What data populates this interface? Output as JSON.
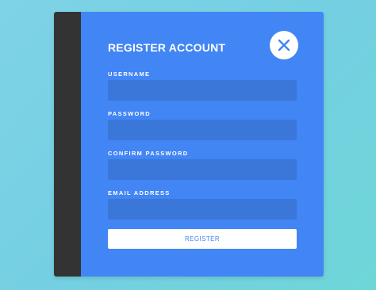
{
  "form": {
    "title": "REGISTER ACCOUNT",
    "close_icon": "close-x-icon",
    "fields": [
      {
        "label": "USERNAME",
        "value": "",
        "placeholder": ""
      },
      {
        "label": "PASSWORD",
        "value": "",
        "placeholder": ""
      },
      {
        "label": "CONFIRM PASSWORD",
        "value": "",
        "placeholder": ""
      },
      {
        "label": "EMAIL ADDRESS",
        "value": "",
        "placeholder": ""
      }
    ],
    "submit_label": "REGISTER"
  },
  "colors": {
    "background": "#7fd3e6",
    "panel": "#4285f4",
    "side_bar": "#333333",
    "input": "#3b76d9",
    "button": "#ffffff",
    "button_text": "#4285f4"
  }
}
